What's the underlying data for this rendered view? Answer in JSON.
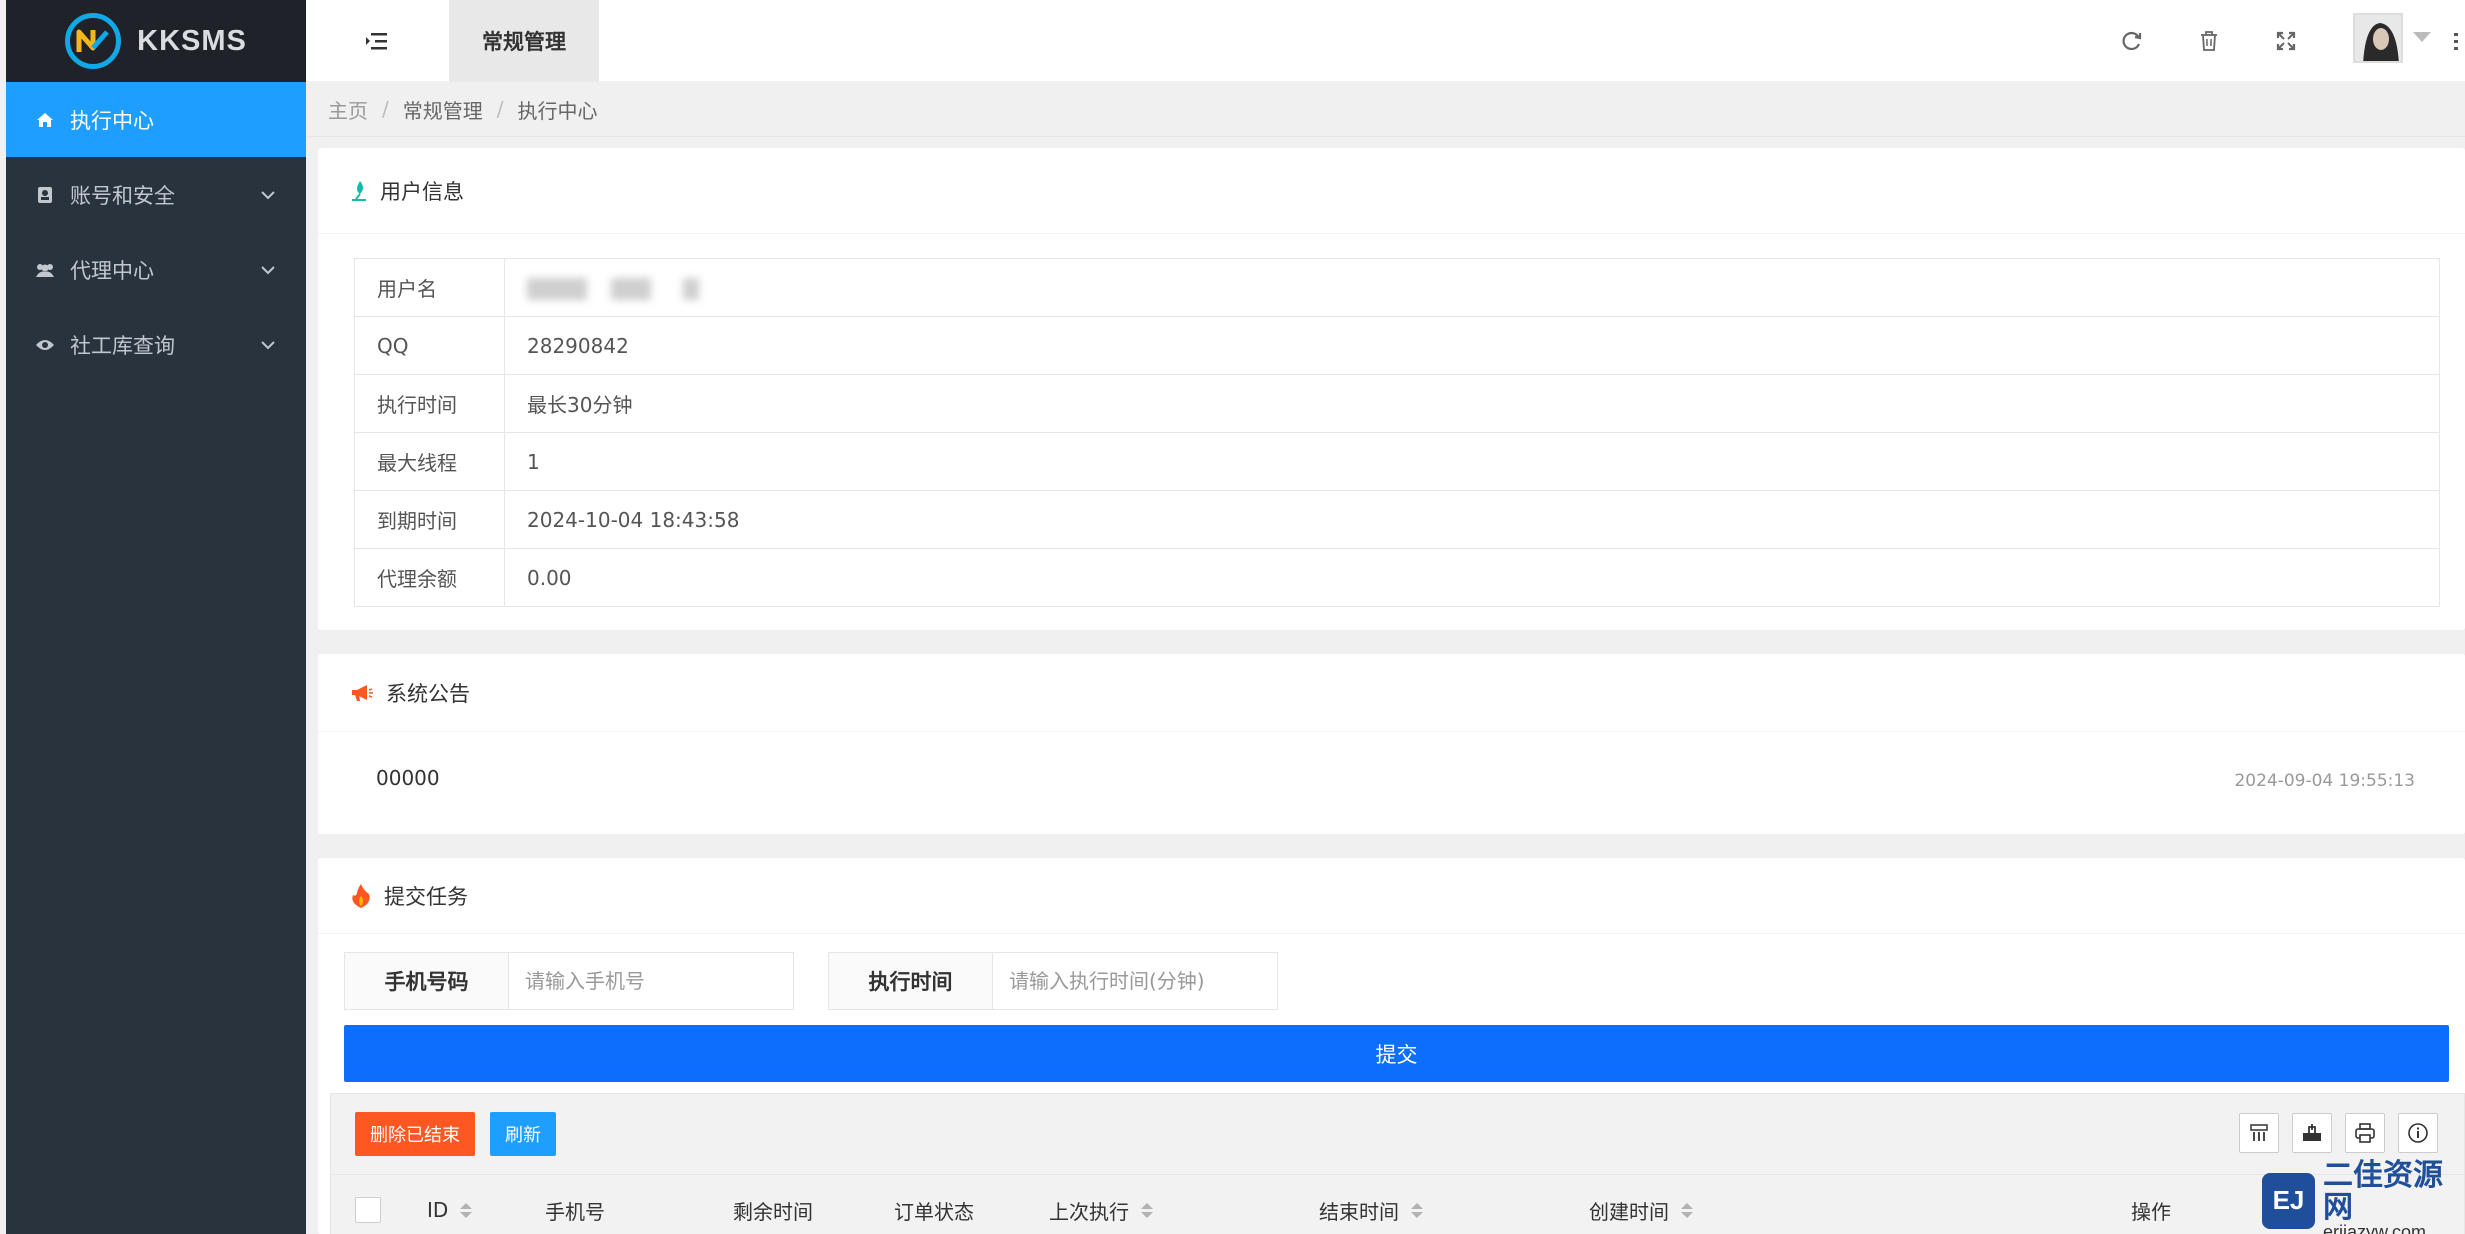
{
  "app": {
    "logo_text": "KKSMS"
  },
  "sidebar": {
    "items": [
      {
        "label": "执行中心",
        "icon": "home-icon",
        "active": true
      },
      {
        "label": "账号和安全",
        "icon": "contact-card-icon"
      },
      {
        "label": "代理中心",
        "icon": "users-icon"
      },
      {
        "label": "社工库查询",
        "icon": "eye-icon"
      }
    ]
  },
  "header": {
    "tab_label": "常规管理",
    "icons": [
      "menu-toggle-icon",
      "refresh-icon",
      "trash-icon",
      "fullscreen-icon",
      "avatar",
      "more-icon"
    ]
  },
  "breadcrumb": {
    "home": "主页",
    "section": "常规管理",
    "current": "执行中心",
    "separator": "/"
  },
  "user_info": {
    "title": "用户信息",
    "rows": [
      {
        "key": "用户名",
        "value": ""
      },
      {
        "key": "QQ",
        "value": "28290842"
      },
      {
        "key": "执行时间",
        "value": "最长30分钟"
      },
      {
        "key": "最大线程",
        "value": "1"
      },
      {
        "key": "到期时间",
        "value": "2024-10-04 18:43:58"
      },
      {
        "key": "代理余额",
        "value": "0.00"
      }
    ]
  },
  "notice": {
    "title": "系统公告",
    "content": "00000",
    "time": "2024-09-04 19:55:13"
  },
  "task": {
    "title": "提交任务",
    "phone_label": "手机号码",
    "phone_placeholder": "请输入手机号",
    "time_label": "执行时间",
    "time_placeholder": "请输入执行时间(分钟)",
    "submit_label": "提交",
    "delete_label": "删除已结束",
    "refresh_label": "刷新",
    "table_headers": [
      "ID",
      "手机号",
      "剩余时间",
      "订单状态",
      "上次执行",
      "结束时间",
      "创建时间",
      "操作"
    ]
  },
  "watermark": {
    "logo": "EJ",
    "title": "二佳资源网",
    "url": "erjiazyw.com"
  },
  "colors": {
    "sidebar_bg": "#28333e",
    "active": "#1e9fff",
    "submit": "#0d6efd",
    "danger": "#ff5722"
  }
}
